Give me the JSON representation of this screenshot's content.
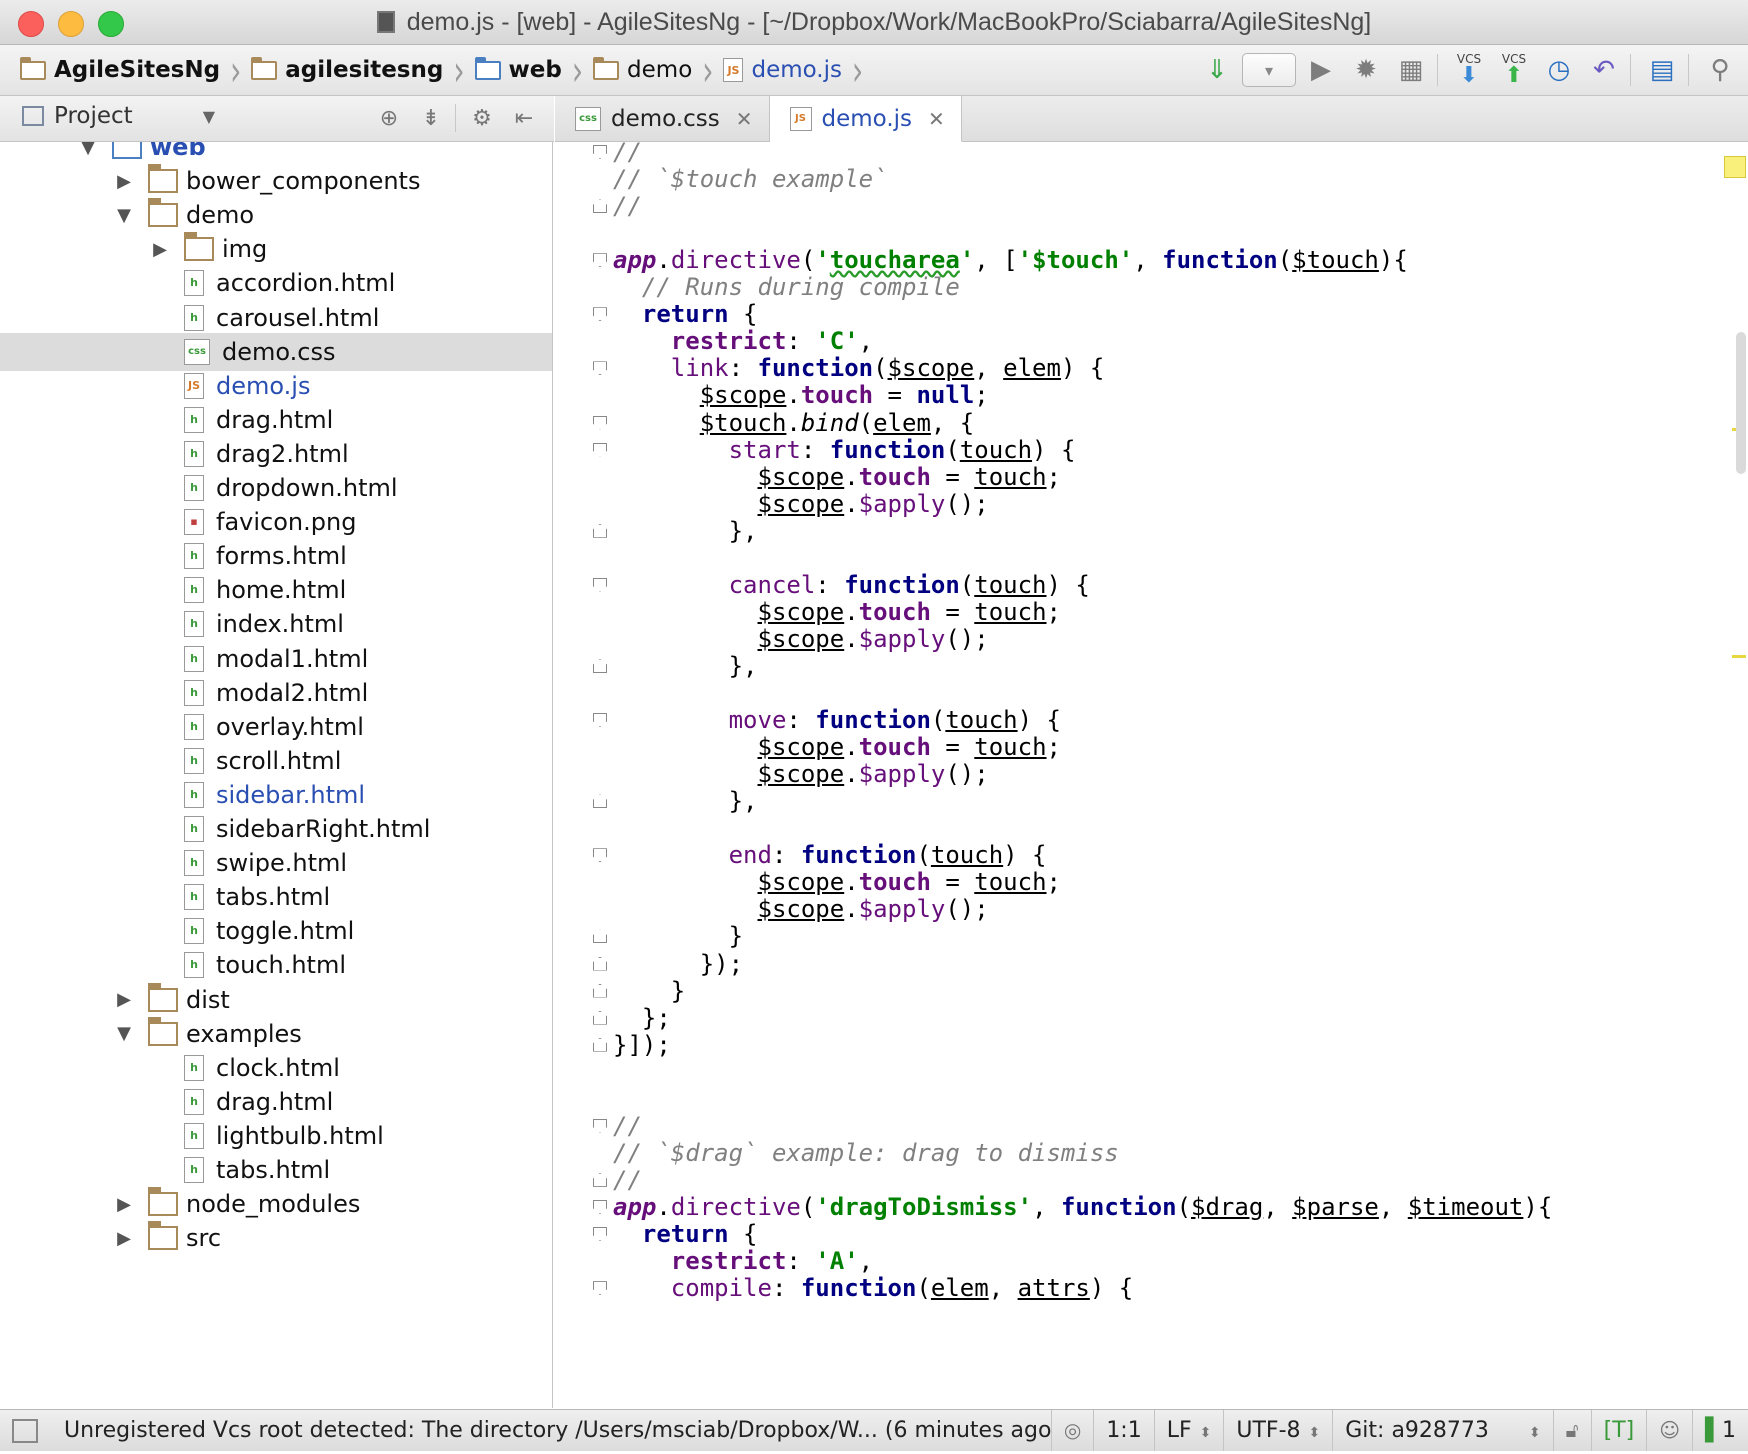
{
  "window": {
    "title": "demo.js - [web] - AgileSitesNg - [~/Dropbox/Work/MacBookPro/Sciabarra/AgileSitesNg]"
  },
  "breadcrumbs": [
    {
      "label": "AgileSitesNg",
      "bold": true,
      "icon": "folder-icon"
    },
    {
      "label": "agilesitesng",
      "bold": true,
      "icon": "folder-icon"
    },
    {
      "label": "web",
      "bold": true,
      "icon": "web-folder-icon"
    },
    {
      "label": "demo",
      "bold": false,
      "icon": "folder-icon"
    },
    {
      "label": "demo.js",
      "bold": false,
      "icon": "js-file-icon"
    }
  ],
  "toolbar": {
    "vcs_update_label": "VCS",
    "vcs_commit_label": "VCS"
  },
  "project_panel": {
    "view_label": "Project"
  },
  "tree": [
    {
      "label": "web",
      "type": "web-folder",
      "level": 1,
      "expanded": true,
      "style": "bluebold"
    },
    {
      "label": "bower_components",
      "type": "folder",
      "level": 2,
      "expanded": false
    },
    {
      "label": "demo",
      "type": "folder",
      "level": 2,
      "expanded": true
    },
    {
      "label": "img",
      "type": "folder",
      "level": 3,
      "expanded": false
    },
    {
      "label": "accordion.html",
      "type": "html",
      "level": 3
    },
    {
      "label": "carousel.html",
      "type": "html",
      "level": 3
    },
    {
      "label": "demo.css",
      "type": "css",
      "level": 3,
      "selected": true
    },
    {
      "label": "demo.js",
      "type": "js",
      "level": 3,
      "style": "blue"
    },
    {
      "label": "drag.html",
      "type": "html",
      "level": 3
    },
    {
      "label": "drag2.html",
      "type": "html",
      "level": 3
    },
    {
      "label": "dropdown.html",
      "type": "html",
      "level": 3
    },
    {
      "label": "favicon.png",
      "type": "png",
      "level": 3
    },
    {
      "label": "forms.html",
      "type": "html",
      "level": 3
    },
    {
      "label": "home.html",
      "type": "html",
      "level": 3
    },
    {
      "label": "index.html",
      "type": "html",
      "level": 3
    },
    {
      "label": "modal1.html",
      "type": "html",
      "level": 3
    },
    {
      "label": "modal2.html",
      "type": "html",
      "level": 3
    },
    {
      "label": "overlay.html",
      "type": "html",
      "level": 3
    },
    {
      "label": "scroll.html",
      "type": "html",
      "level": 3
    },
    {
      "label": "sidebar.html",
      "type": "html",
      "level": 3,
      "style": "blue"
    },
    {
      "label": "sidebarRight.html",
      "type": "html",
      "level": 3
    },
    {
      "label": "swipe.html",
      "type": "html",
      "level": 3
    },
    {
      "label": "tabs.html",
      "type": "html",
      "level": 3
    },
    {
      "label": "toggle.html",
      "type": "html",
      "level": 3
    },
    {
      "label": "touch.html",
      "type": "html",
      "level": 3
    },
    {
      "label": "dist",
      "type": "folder",
      "level": 2,
      "expanded": false
    },
    {
      "label": "examples",
      "type": "folder",
      "level": 2,
      "expanded": true
    },
    {
      "label": "clock.html",
      "type": "html",
      "level": 3
    },
    {
      "label": "drag.html",
      "type": "html",
      "level": 3
    },
    {
      "label": "lightbulb.html",
      "type": "html",
      "level": 3
    },
    {
      "label": "tabs.html",
      "type": "html",
      "level": 3
    },
    {
      "label": "node_modules",
      "type": "folder",
      "level": 2,
      "expanded": false
    },
    {
      "label": "src",
      "type": "folder",
      "level": 2,
      "expanded": false
    }
  ],
  "tabs": [
    {
      "label": "demo.css",
      "type": "css",
      "active": false
    },
    {
      "label": "demo.js",
      "type": "js",
      "active": true
    }
  ],
  "code": [
    {
      "fold": "start",
      "tokens": [
        [
          "c-com",
          "//"
        ]
      ]
    },
    {
      "tokens": [
        [
          "c-com",
          "// `$touch example`"
        ]
      ]
    },
    {
      "fold": "end",
      "tokens": [
        [
          "c-com",
          "//"
        ]
      ]
    },
    {
      "tokens": []
    },
    {
      "fold": "start",
      "tokens": [
        [
          "c-app",
          "app"
        ],
        [
          "c-plain",
          "."
        ],
        [
          "c-fn",
          "directive"
        ],
        [
          "c-plain",
          "("
        ],
        [
          "c-str",
          "'"
        ],
        [
          "c-str c-wavy",
          "toucharea"
        ],
        [
          "c-str",
          "'"
        ],
        [
          "c-plain",
          ", ["
        ],
        [
          "c-str",
          "'$touch'"
        ],
        [
          "c-plain",
          ", "
        ],
        [
          "c-kw",
          "function"
        ],
        [
          "c-plain",
          "("
        ],
        [
          "c-plain c-ul",
          "$touch"
        ],
        [
          "c-plain",
          "){"
        ]
      ]
    },
    {
      "tokens": [
        [
          "c-plain",
          "  "
        ],
        [
          "c-com",
          "// Runs during compile"
        ]
      ]
    },
    {
      "fold": "start",
      "tokens": [
        [
          "c-plain",
          "  "
        ],
        [
          "c-kw",
          "return"
        ],
        [
          "c-plain",
          " {"
        ]
      ]
    },
    {
      "tokens": [
        [
          "c-plain",
          "    "
        ],
        [
          "c-prop",
          "restrict"
        ],
        [
          "c-plain",
          ": "
        ],
        [
          "c-str",
          "'C'"
        ],
        [
          "c-plain",
          ","
        ]
      ]
    },
    {
      "fold": "start",
      "tokens": [
        [
          "c-plain",
          "    "
        ],
        [
          "c-fn",
          "link"
        ],
        [
          "c-plain",
          ": "
        ],
        [
          "c-kw",
          "function"
        ],
        [
          "c-plain",
          "("
        ],
        [
          "c-plain c-ul",
          "$scope"
        ],
        [
          "c-plain",
          ", "
        ],
        [
          "c-plain c-ul",
          "elem"
        ],
        [
          "c-plain",
          ") {"
        ]
      ]
    },
    {
      "tokens": [
        [
          "c-plain",
          "      "
        ],
        [
          "c-plain c-ul",
          "$scope"
        ],
        [
          "c-plain",
          "."
        ],
        [
          "c-prop",
          "touch"
        ],
        [
          "c-plain",
          " = "
        ],
        [
          "c-kw",
          "null"
        ],
        [
          "c-plain",
          ";"
        ]
      ]
    },
    {
      "fold": "start",
      "tokens": [
        [
          "c-plain",
          "      "
        ],
        [
          "c-plain c-ul",
          "$touch"
        ],
        [
          "c-plain",
          "."
        ],
        [
          "c-plain c-it",
          "bind"
        ],
        [
          "c-plain",
          "("
        ],
        [
          "c-plain c-ul",
          "elem"
        ],
        [
          "c-plain",
          ", {"
        ]
      ]
    },
    {
      "fold": "start",
      "tokens": [
        [
          "c-plain",
          "        "
        ],
        [
          "c-fn",
          "start"
        ],
        [
          "c-plain",
          ": "
        ],
        [
          "c-kw",
          "function"
        ],
        [
          "c-plain",
          "("
        ],
        [
          "c-plain c-ul",
          "touch"
        ],
        [
          "c-plain",
          ") {"
        ]
      ]
    },
    {
      "tokens": [
        [
          "c-plain",
          "          "
        ],
        [
          "c-plain c-ul",
          "$scope"
        ],
        [
          "c-plain",
          "."
        ],
        [
          "c-prop",
          "touch"
        ],
        [
          "c-plain",
          " = "
        ],
        [
          "c-plain c-ul",
          "touch"
        ],
        [
          "c-plain",
          ";"
        ]
      ]
    },
    {
      "tokens": [
        [
          "c-plain",
          "          "
        ],
        [
          "c-plain c-ul",
          "$scope"
        ],
        [
          "c-plain",
          "."
        ],
        [
          "c-fn",
          "$apply"
        ],
        [
          "c-plain",
          "();"
        ]
      ]
    },
    {
      "fold": "end",
      "tokens": [
        [
          "c-plain",
          "        },"
        ]
      ]
    },
    {
      "tokens": []
    },
    {
      "fold": "start",
      "tokens": [
        [
          "c-plain",
          "        "
        ],
        [
          "c-fn",
          "cancel"
        ],
        [
          "c-plain",
          ": "
        ],
        [
          "c-kw",
          "function"
        ],
        [
          "c-plain",
          "("
        ],
        [
          "c-plain c-ul",
          "touch"
        ],
        [
          "c-plain",
          ") {"
        ]
      ]
    },
    {
      "tokens": [
        [
          "c-plain",
          "          "
        ],
        [
          "c-plain c-ul",
          "$scope"
        ],
        [
          "c-plain",
          "."
        ],
        [
          "c-prop",
          "touch"
        ],
        [
          "c-plain",
          " = "
        ],
        [
          "c-plain c-ul",
          "touch"
        ],
        [
          "c-plain",
          ";"
        ]
      ]
    },
    {
      "tokens": [
        [
          "c-plain",
          "          "
        ],
        [
          "c-plain c-ul",
          "$scope"
        ],
        [
          "c-plain",
          "."
        ],
        [
          "c-fn",
          "$apply"
        ],
        [
          "c-plain",
          "();"
        ]
      ]
    },
    {
      "fold": "end",
      "tokens": [
        [
          "c-plain",
          "        },"
        ]
      ]
    },
    {
      "tokens": []
    },
    {
      "fold": "start",
      "tokens": [
        [
          "c-plain",
          "        "
        ],
        [
          "c-fn",
          "move"
        ],
        [
          "c-plain",
          ": "
        ],
        [
          "c-kw",
          "function"
        ],
        [
          "c-plain",
          "("
        ],
        [
          "c-plain c-ul",
          "touch"
        ],
        [
          "c-plain",
          ") {"
        ]
      ]
    },
    {
      "tokens": [
        [
          "c-plain",
          "          "
        ],
        [
          "c-plain c-ul",
          "$scope"
        ],
        [
          "c-plain",
          "."
        ],
        [
          "c-prop",
          "touch"
        ],
        [
          "c-plain",
          " = "
        ],
        [
          "c-plain c-ul",
          "touch"
        ],
        [
          "c-plain",
          ";"
        ]
      ]
    },
    {
      "tokens": [
        [
          "c-plain",
          "          "
        ],
        [
          "c-plain c-ul",
          "$scope"
        ],
        [
          "c-plain",
          "."
        ],
        [
          "c-fn",
          "$apply"
        ],
        [
          "c-plain",
          "();"
        ]
      ]
    },
    {
      "fold": "end",
      "tokens": [
        [
          "c-plain",
          "        },"
        ]
      ]
    },
    {
      "tokens": []
    },
    {
      "fold": "start",
      "tokens": [
        [
          "c-plain",
          "        "
        ],
        [
          "c-fn",
          "end"
        ],
        [
          "c-plain",
          ": "
        ],
        [
          "c-kw",
          "function"
        ],
        [
          "c-plain",
          "("
        ],
        [
          "c-plain c-ul",
          "touch"
        ],
        [
          "c-plain",
          ") {"
        ]
      ]
    },
    {
      "tokens": [
        [
          "c-plain",
          "          "
        ],
        [
          "c-plain c-ul",
          "$scope"
        ],
        [
          "c-plain",
          "."
        ],
        [
          "c-prop",
          "touch"
        ],
        [
          "c-plain",
          " = "
        ],
        [
          "c-plain c-ul",
          "touch"
        ],
        [
          "c-plain",
          ";"
        ]
      ]
    },
    {
      "tokens": [
        [
          "c-plain",
          "          "
        ],
        [
          "c-plain c-ul",
          "$scope"
        ],
        [
          "c-plain",
          "."
        ],
        [
          "c-fn",
          "$apply"
        ],
        [
          "c-plain",
          "();"
        ]
      ]
    },
    {
      "fold": "end",
      "tokens": [
        [
          "c-plain",
          "        }"
        ]
      ]
    },
    {
      "fold": "end",
      "tokens": [
        [
          "c-plain",
          "      });"
        ]
      ]
    },
    {
      "fold": "end",
      "tokens": [
        [
          "c-plain",
          "    }"
        ]
      ]
    },
    {
      "fold": "end",
      "tokens": [
        [
          "c-plain",
          "  };"
        ]
      ]
    },
    {
      "fold": "end",
      "tokens": [
        [
          "c-plain",
          "}]);"
        ]
      ]
    },
    {
      "tokens": []
    },
    {
      "tokens": []
    },
    {
      "fold": "start",
      "tokens": [
        [
          "c-com",
          "//"
        ]
      ]
    },
    {
      "tokens": [
        [
          "c-com",
          "// `$drag` example: drag to dismiss"
        ]
      ]
    },
    {
      "fold": "end",
      "tokens": [
        [
          "c-com",
          "//"
        ]
      ]
    },
    {
      "fold": "start",
      "tokens": [
        [
          "c-app",
          "app"
        ],
        [
          "c-plain",
          "."
        ],
        [
          "c-fn",
          "directive"
        ],
        [
          "c-plain",
          "("
        ],
        [
          "c-str",
          "'dragToDismiss'"
        ],
        [
          "c-plain",
          ", "
        ],
        [
          "c-kw",
          "function"
        ],
        [
          "c-plain",
          "("
        ],
        [
          "c-plain c-ul",
          "$drag"
        ],
        [
          "c-plain",
          ", "
        ],
        [
          "c-plain c-ul",
          "$parse"
        ],
        [
          "c-plain",
          ", "
        ],
        [
          "c-plain c-ul",
          "$timeout"
        ],
        [
          "c-plain",
          "){"
        ]
      ]
    },
    {
      "fold": "start",
      "tokens": [
        [
          "c-plain",
          "  "
        ],
        [
          "c-kw",
          "return"
        ],
        [
          "c-plain",
          " {"
        ]
      ]
    },
    {
      "tokens": [
        [
          "c-plain",
          "    "
        ],
        [
          "c-prop",
          "restrict"
        ],
        [
          "c-plain",
          ": "
        ],
        [
          "c-str",
          "'A'"
        ],
        [
          "c-plain",
          ","
        ]
      ]
    },
    {
      "fold": "start",
      "tokens": [
        [
          "c-plain",
          "    "
        ],
        [
          "c-fn",
          "compile"
        ],
        [
          "c-plain",
          ": "
        ],
        [
          "c-kw",
          "function"
        ],
        [
          "c-plain",
          "("
        ],
        [
          "c-plain c-ul",
          "elem"
        ],
        [
          "c-plain",
          ", "
        ],
        [
          "c-plain c-ul",
          "attrs"
        ],
        [
          "c-plain",
          ") {"
        ]
      ]
    }
  ],
  "status": {
    "message": "Unregistered Vcs root detected: The directory /Users/msciab/Dropbox/W... (6 minutes ago)",
    "position": "1:1",
    "line_sep": "LF",
    "encoding": "UTF-8",
    "git_branch": "Git: a928773",
    "t_badge": "[T]",
    "event_count": "1"
  }
}
